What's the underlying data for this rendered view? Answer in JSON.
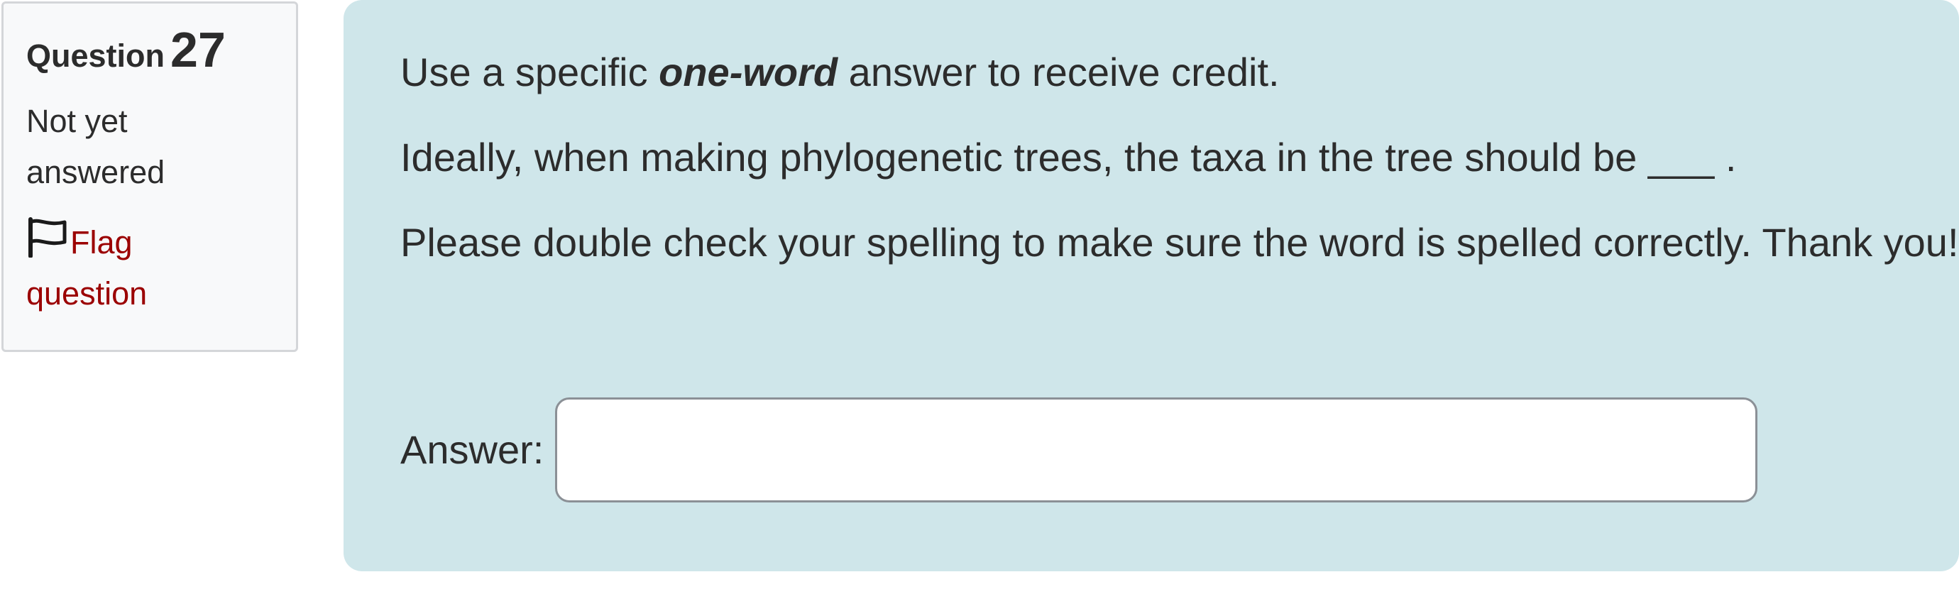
{
  "question_info": {
    "label": "Question",
    "number": "27",
    "state": "Not yet answered",
    "flag_label": "Flag question"
  },
  "question": {
    "instruction_before": "Use a specific ",
    "instruction_emphasis": "one-word",
    "instruction_after": " answer to receive credit.",
    "prompt": "Ideally, when making phylogenetic trees, the taxa in the tree should be ___ .",
    "note": "Please double check your spelling to make sure the word is spelled correctly. Thank you!",
    "answer_label": "Answer:",
    "answer_value": ""
  },
  "colors": {
    "content_background": "#cfe6ea",
    "info_background": "#f8f9fa",
    "flag_link": "#9b0000",
    "text": "#2c2c2c"
  },
  "icons": {
    "flag": "flag-outline-icon"
  }
}
